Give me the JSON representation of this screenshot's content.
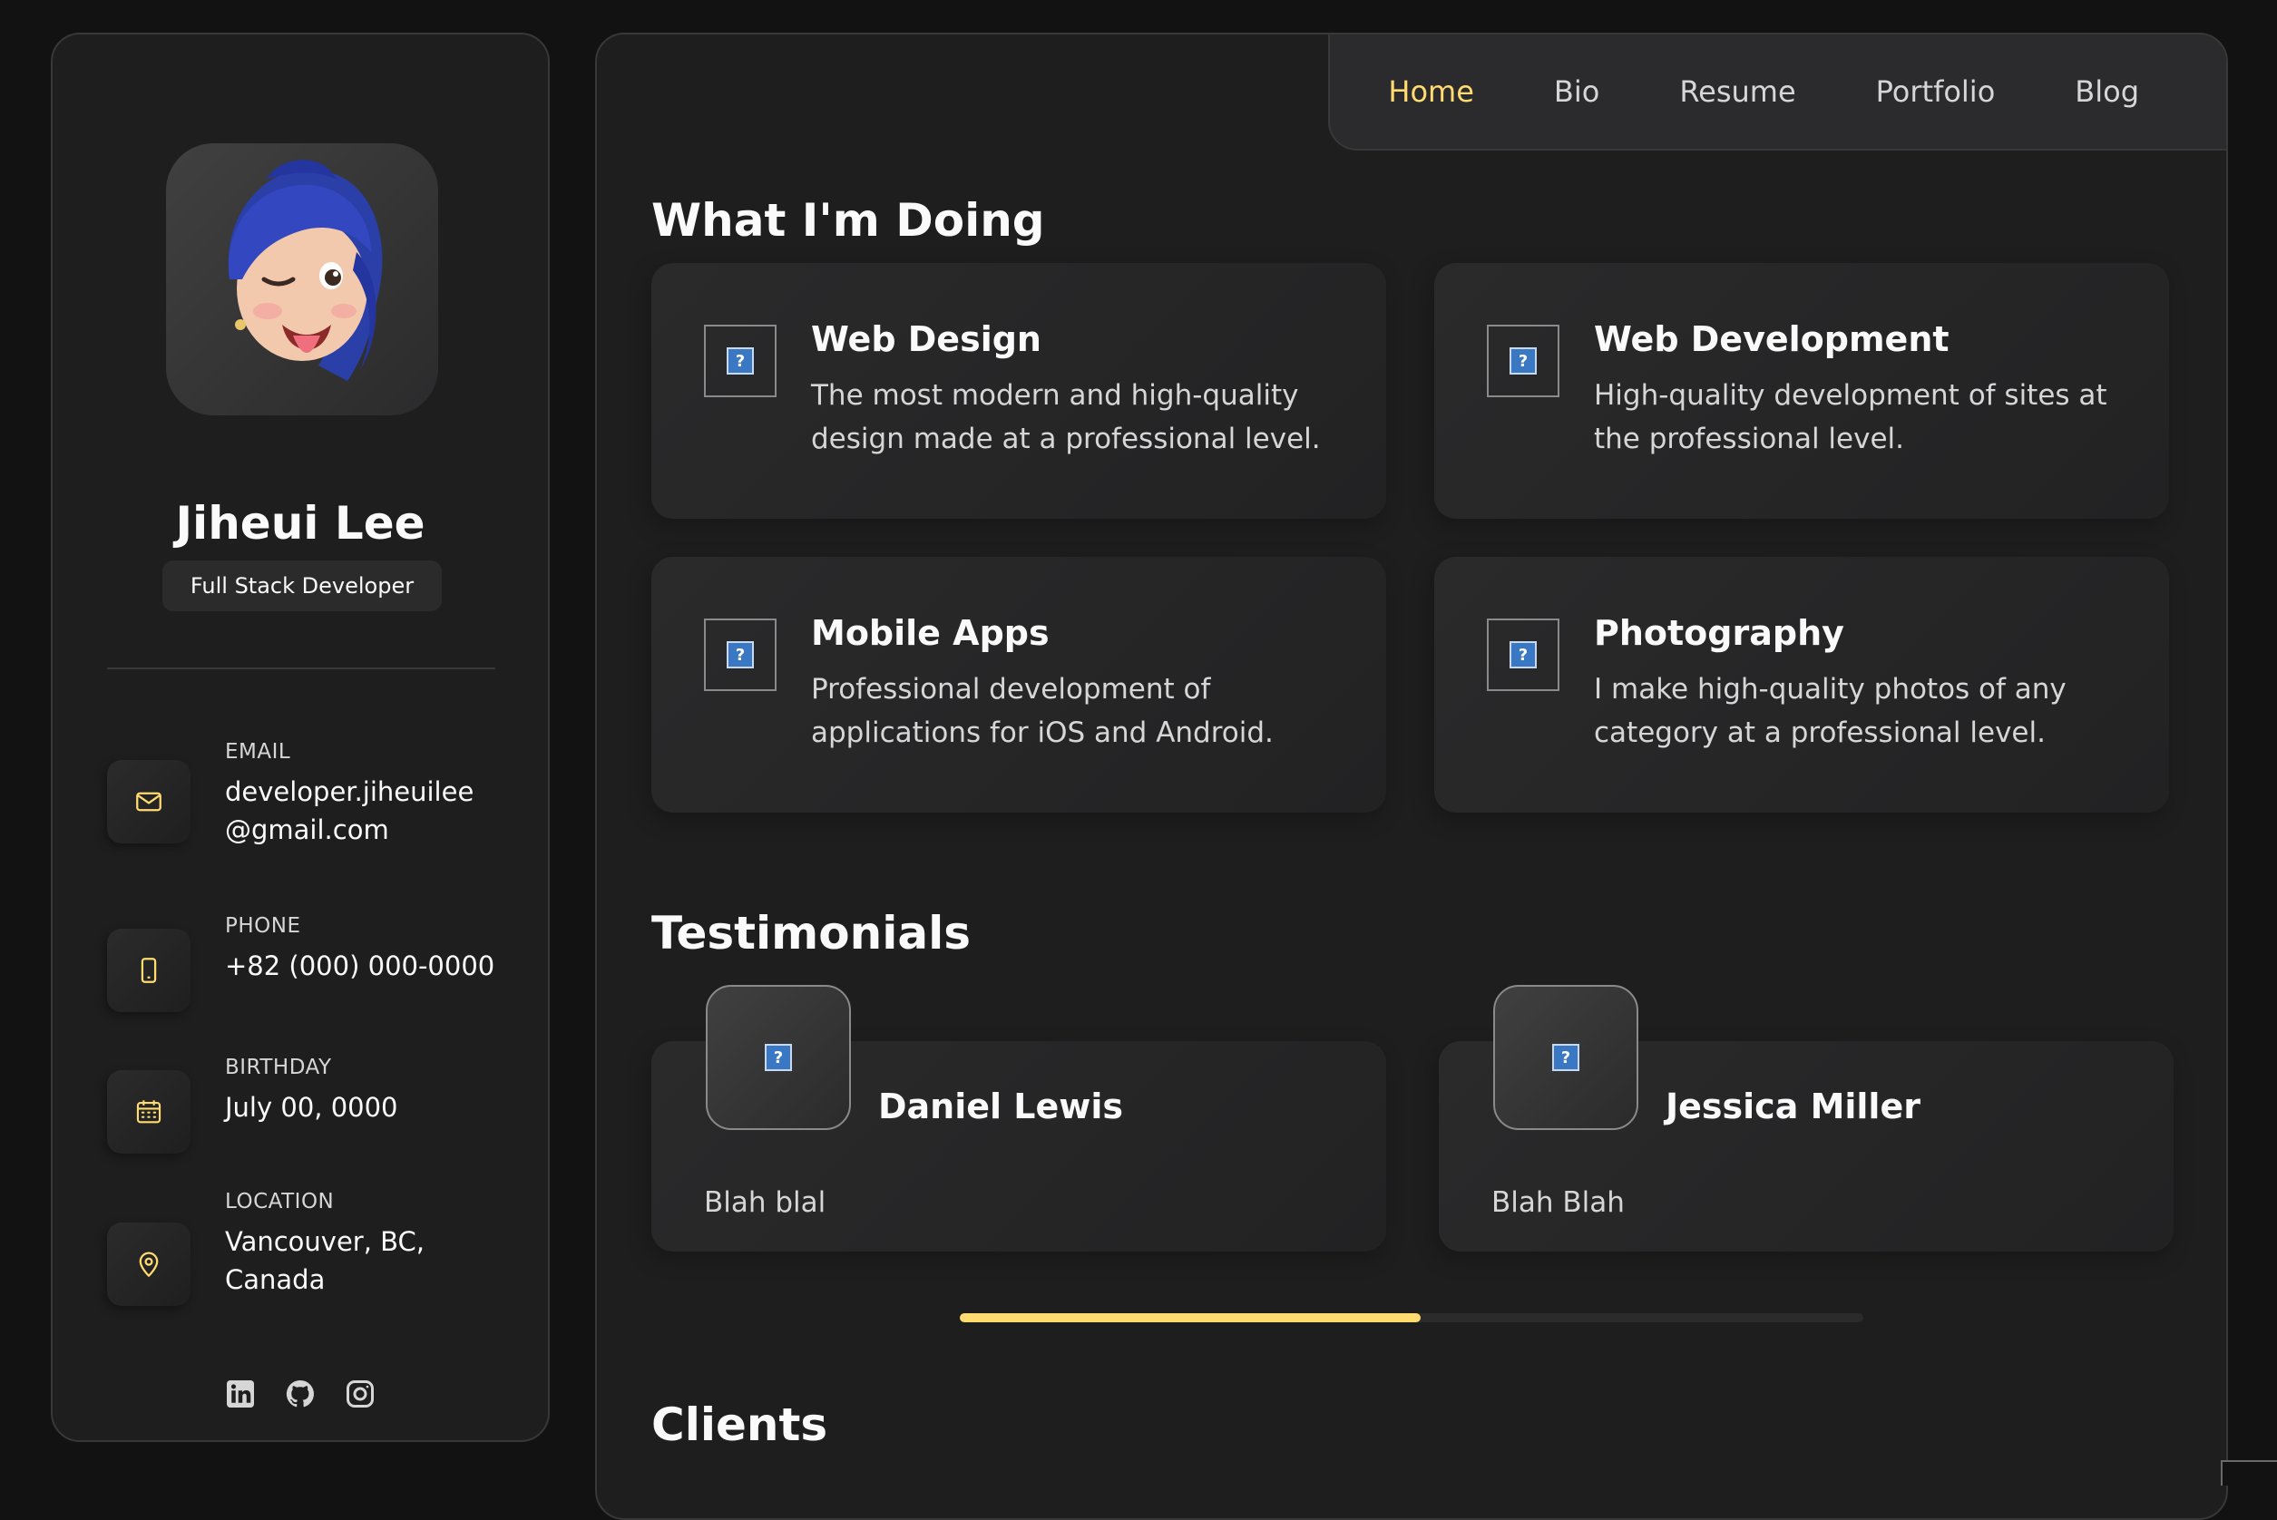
{
  "profile": {
    "name": "Jiheui Lee",
    "role": "Full Stack Developer",
    "avatar_icon": "memoji-avatar"
  },
  "contacts": [
    {
      "label": "EMAIL",
      "value": "developer.jiheuilee @gmail.com",
      "icon": "mail-icon"
    },
    {
      "label": "PHONE",
      "value": "+82 (000) 000-0000",
      "icon": "phone-icon"
    },
    {
      "label": "BIRTHDAY",
      "value": "July 00, 0000",
      "icon": "calendar-icon"
    },
    {
      "label": "LOCATION",
      "value": "Vancouver, BC, Canada",
      "icon": "location-pin-icon"
    }
  ],
  "socials": [
    "linkedin-icon",
    "github-icon",
    "instagram-icon"
  ],
  "nav": {
    "items": [
      "Home",
      "Bio",
      "Resume",
      "Portfolio",
      "Blog"
    ],
    "active": "Home"
  },
  "services": {
    "title": "What I'm Doing",
    "items": [
      {
        "title": "Web Design",
        "text": "The most modern and high-quality design made at a professional level."
      },
      {
        "title": "Web Development",
        "text": "High-quality development of sites at the professional level."
      },
      {
        "title": "Mobile Apps",
        "text": "Professional development of applications for iOS and Android."
      },
      {
        "title": "Photography",
        "text": "I make high-quality photos of any category at a professional level."
      }
    ]
  },
  "testimonials": {
    "title": "Testimonials",
    "items": [
      {
        "name": "Daniel Lewis",
        "text": "Blah blal"
      },
      {
        "name": "Jessica Miller",
        "text": "Blah Blah"
      }
    ],
    "scroll_progress": 0.51
  },
  "clients": {
    "title": "Clients"
  },
  "colors": {
    "accent": "#ffdb70",
    "background": "#121212",
    "panel": "#1e1e1f",
    "border": "#383838"
  }
}
